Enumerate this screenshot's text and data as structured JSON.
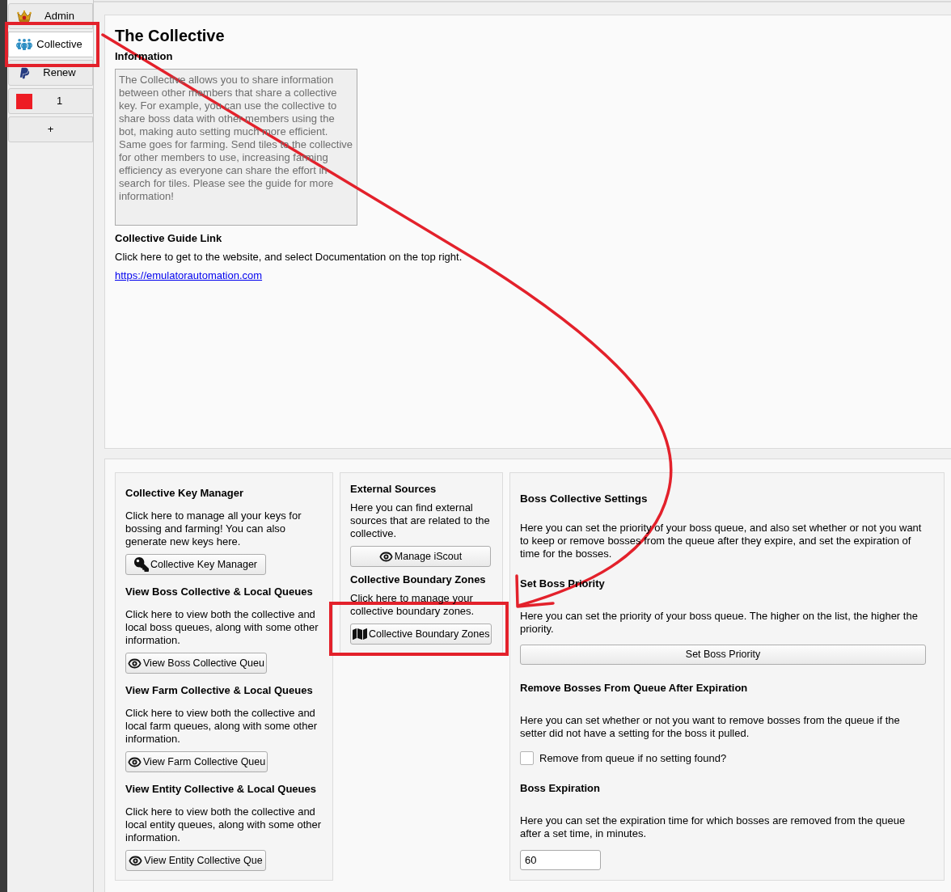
{
  "sidebar": {
    "tabs": [
      {
        "label": "Admin",
        "kind": "admin",
        "selected": false
      },
      {
        "label": "Collective",
        "kind": "collective",
        "selected": true
      },
      {
        "label": "Renew",
        "kind": "renew",
        "selected": false
      },
      {
        "label": "1",
        "kind": "profile",
        "color": "#ed1c24",
        "selected": false
      },
      {
        "label": "+",
        "kind": "add",
        "selected": false
      }
    ]
  },
  "page": {
    "title": "The Collective",
    "information": {
      "heading": "Information",
      "text": "The Collective allows you to share information between other members that share a collective key. For example, you can use the collective to share boss data with other members using the bot, making auto setting much more efficient. Same goes for farming. Send tiles to the collective for other members to use, increasing farming efficiency as everyone can share the effort in search for tiles. Please see the guide for more information!"
    },
    "guide": {
      "heading": "Collective Guide Link",
      "text": "Click here to get to the website, and select Documentation on the top right.",
      "link": "https://emulatorautomation.com"
    }
  },
  "sections": {
    "left": [
      {
        "heading": "Collective Key Manager",
        "text": "Click here to manage all your keys for bossing and farming! You can also generate new keys here.",
        "button": {
          "label": "Collective Key Manager",
          "kind": "key"
        }
      },
      {
        "heading": "View Boss Collective & Local Queues",
        "text": "Click here to view both the collective and local boss queues, along with some other information.",
        "button": {
          "label": "View Boss Collective Queu",
          "kind": "view"
        }
      },
      {
        "heading": "View Farm Collective & Local Queues",
        "text": "Click here to view both the collective and local farm queues, along with some other information.",
        "button": {
          "label": "View Farm Collective Queu",
          "kind": "view"
        }
      },
      {
        "heading": "View Entity Collective & Local Queues",
        "text": "Click here to view both the collective and local entity queues, along with some other information.",
        "button": {
          "label": "View Entity Collective Que",
          "kind": "view"
        }
      }
    ],
    "middle": [
      {
        "heading": "External Sources",
        "text": "Here you can find external sources that are related to the collective.",
        "button": {
          "label": "Manage iScout",
          "kind": "view"
        }
      },
      {
        "heading": "Collective Boundary Zones",
        "text": "Click here to manage your collective boundary zones.",
        "button": {
          "label": "Collective Boundary Zones",
          "kind": "map"
        }
      }
    ],
    "settings": {
      "heading": "Boss Collective Settings",
      "text": "Here you can set the priority of your boss queue, and also set whether or not you want to keep or remove bosses from the queue after they expire, and set the expiration of time for the bosses.",
      "groups": [
        {
          "kind": "button",
          "heading": "Set Boss Priority",
          "text": "Here you can set the priority of your boss queue. The higher on the list, the higher the priority.",
          "button": {
            "label": "Set Boss Priority"
          }
        },
        {
          "kind": "checkbox",
          "heading": "Remove Bosses From Queue After Expiration",
          "text": "Here you can set whether or not you want to remove bosses from the queue if the setter did not have a setting for the boss it pulled.",
          "checkbox": {
            "label": "Remove from queue if no setting found?",
            "checked": false
          }
        },
        {
          "kind": "input",
          "heading": "Boss Expiration",
          "text": "Here you can set the expiration time for which bosses are removed from the queue after a set time, in minutes.",
          "input": {
            "value": "60"
          }
        }
      ]
    }
  }
}
